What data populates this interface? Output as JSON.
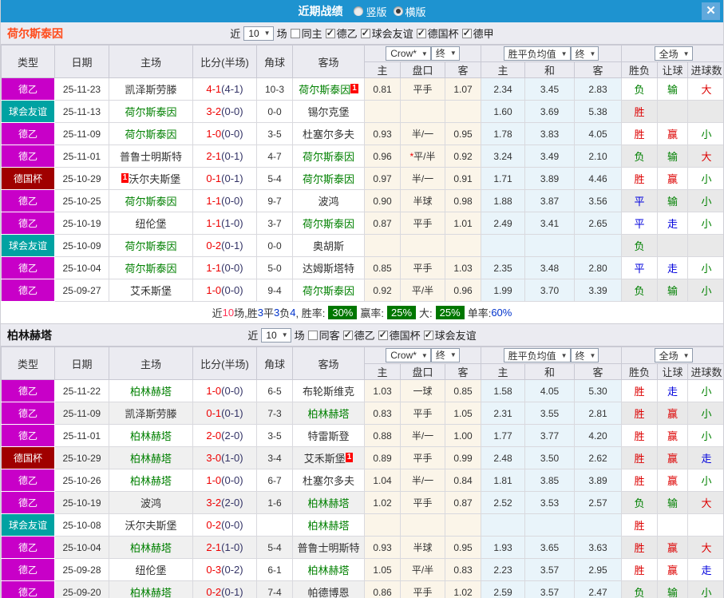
{
  "titlebar": {
    "title": "近期战绩",
    "radios": [
      {
        "label": "竖版",
        "checked": false
      },
      {
        "label": "横版",
        "checked": true
      }
    ],
    "close_icon": "✕"
  },
  "league_colors": {
    "德乙": "#c800c8",
    "球会友谊": "#00a2a2",
    "德国杯": "#a00000"
  },
  "result_colors": {
    "胜": "#dd0000",
    "平": "#0000dd",
    "负": "#008000",
    "赢": "#dd0000",
    "走": "#0000dd",
    "输": "#008000",
    "大": "#dd0000",
    "小": "#008000"
  },
  "summary_text_colors": {
    "k": "#333333",
    "r": "#ff3355",
    "b": "#0033cc"
  },
  "sections": [
    {
      "team": "荷尔斯泰因",
      "team_color": "#ff4a1a",
      "alt_main_shading": false,
      "controls": {
        "near_label": "近",
        "count_value": "10",
        "matches_label": "场",
        "same_checkbox": {
          "label": "同主",
          "checked": false
        },
        "league_checkboxes": [
          {
            "label": "德乙",
            "checked": true
          },
          {
            "label": "球会友谊",
            "checked": true
          },
          {
            "label": "德国杯",
            "checked": true
          },
          {
            "label": "德甲",
            "checked": true
          }
        ]
      },
      "dropdowns": {
        "company": "Crow*",
        "company_state": "终",
        "europe": "胜平负均值",
        "europe_state": "终",
        "scope": "全场"
      },
      "columns": [
        "类型",
        "日期",
        "主场",
        "比分(半场)",
        "角球",
        "客场"
      ],
      "odds_columns": [
        "主",
        "盘口",
        "客",
        "主",
        "和",
        "客",
        "胜负",
        "让球",
        "进球数"
      ],
      "rows": [
        {
          "lg": "德乙",
          "date": "25-11-23",
          "home": {
            "n": "凯泽斯劳滕"
          },
          "score": "4-1",
          "half": "(4-1)",
          "corner": "10-3",
          "away": {
            "n": "荷尔斯泰因",
            "self": true,
            "card": "1",
            "cardpos": "after"
          },
          "ah": [
            "0.81",
            "平手",
            "1.07"
          ],
          "eu": [
            "2.34",
            "3.45",
            "2.83"
          ],
          "res": [
            "负",
            "输",
            "大"
          ]
        },
        {
          "lg": "球会友谊",
          "date": "25-11-13",
          "home": {
            "n": "荷尔斯泰因",
            "self": true
          },
          "score": "3-2",
          "half": "(0-0)",
          "corner": "0-0",
          "away": {
            "n": "锡尔克堡"
          },
          "ah": [
            "",
            "",
            ""
          ],
          "eu": [
            "1.60",
            "3.69",
            "5.38"
          ],
          "res": [
            "胜",
            "",
            ""
          ]
        },
        {
          "lg": "德乙",
          "date": "25-11-09",
          "home": {
            "n": "荷尔斯泰因",
            "self": true
          },
          "score": "1-0",
          "half": "(0-0)",
          "corner": "3-5",
          "away": {
            "n": "杜塞尔多夫"
          },
          "ah": [
            "0.93",
            "半/一",
            "0.95"
          ],
          "eu": [
            "1.78",
            "3.83",
            "4.05"
          ],
          "res": [
            "胜",
            "赢",
            "小"
          ]
        },
        {
          "lg": "德乙",
          "date": "25-11-01",
          "home": {
            "n": "普鲁士明斯特"
          },
          "score": "2-1",
          "half": "(0-1)",
          "corner": "4-7",
          "away": {
            "n": "荷尔斯泰因",
            "self": true
          },
          "ah": [
            "0.96",
            "平/半",
            "0.92"
          ],
          "ah_star": true,
          "eu": [
            "3.24",
            "3.49",
            "2.10"
          ],
          "res": [
            "负",
            "输",
            "大"
          ]
        },
        {
          "lg": "德国杯",
          "date": "25-10-29",
          "home": {
            "n": "沃尔夫斯堡",
            "card": "1",
            "cardpos": "before"
          },
          "score": "0-1",
          "half": "(0-1)",
          "corner": "5-4",
          "away": {
            "n": "荷尔斯泰因",
            "self": true
          },
          "ah": [
            "0.97",
            "半/一",
            "0.91"
          ],
          "eu": [
            "1.71",
            "3.89",
            "4.46"
          ],
          "res": [
            "胜",
            "赢",
            "小"
          ]
        },
        {
          "lg": "德乙",
          "date": "25-10-25",
          "home": {
            "n": "荷尔斯泰因",
            "self": true
          },
          "score": "1-1",
          "half": "(0-0)",
          "corner": "9-7",
          "away": {
            "n": "波鸿"
          },
          "ah": [
            "0.90",
            "半球",
            "0.98"
          ],
          "eu": [
            "1.88",
            "3.87",
            "3.56"
          ],
          "res": [
            "平",
            "输",
            "小"
          ]
        },
        {
          "lg": "德乙",
          "date": "25-10-19",
          "home": {
            "n": "纽伦堡"
          },
          "score": "1-1",
          "half": "(1-0)",
          "corner": "3-7",
          "away": {
            "n": "荷尔斯泰因",
            "self": true
          },
          "ah": [
            "0.87",
            "平手",
            "1.01"
          ],
          "eu": [
            "2.49",
            "3.41",
            "2.65"
          ],
          "res": [
            "平",
            "走",
            "小"
          ]
        },
        {
          "lg": "球会友谊",
          "date": "25-10-09",
          "home": {
            "n": "荷尔斯泰因",
            "self": true
          },
          "score": "0-2",
          "half": "(0-1)",
          "corner": "0-0",
          "away": {
            "n": "奥胡斯"
          },
          "ah": [
            "",
            "",
            ""
          ],
          "eu": [
            "",
            "",
            ""
          ],
          "res": [
            "负",
            "",
            ""
          ]
        },
        {
          "lg": "德乙",
          "date": "25-10-04",
          "home": {
            "n": "荷尔斯泰因",
            "self": true
          },
          "score": "1-1",
          "half": "(0-0)",
          "corner": "5-0",
          "away": {
            "n": "达姆斯塔特"
          },
          "ah": [
            "0.85",
            "平手",
            "1.03"
          ],
          "eu": [
            "2.35",
            "3.48",
            "2.80"
          ],
          "res": [
            "平",
            "走",
            "小"
          ]
        },
        {
          "lg": "德乙",
          "date": "25-09-27",
          "home": {
            "n": "艾禾斯堡"
          },
          "score": "1-0",
          "half": "(0-0)",
          "corner": "9-4",
          "away": {
            "n": "荷尔斯泰因",
            "self": true
          },
          "ah": [
            "0.92",
            "平/半",
            "0.96"
          ],
          "eu": [
            "1.99",
            "3.70",
            "3.39"
          ],
          "res": [
            "负",
            "输",
            "小"
          ]
        }
      ],
      "summary": [
        {
          "t": "近",
          "c": "k"
        },
        {
          "t": "10",
          "c": "r"
        },
        {
          "t": "场,胜",
          "c": "k"
        },
        {
          "t": "3",
          "c": "b"
        },
        {
          "t": "平",
          "c": "k"
        },
        {
          "t": "3",
          "c": "b"
        },
        {
          "t": "负",
          "c": "k"
        },
        {
          "t": "4",
          "c": "b"
        },
        {
          "t": ", 胜率:",
          "c": "k"
        },
        {
          "t": "30%",
          "badge": true
        },
        {
          "t": "赢率:",
          "c": "k"
        },
        {
          "t": "25%",
          "badge": true
        },
        {
          "t": "大:",
          "c": "k"
        },
        {
          "t": "25%",
          "badge": true
        },
        {
          "t": "单率:",
          "c": "k"
        },
        {
          "t": "60%",
          "c": "b"
        }
      ]
    },
    {
      "team": "柏林赫塔",
      "team_color": "#111111",
      "alt_main_shading": true,
      "controls": {
        "near_label": "近",
        "count_value": "10",
        "matches_label": "场",
        "same_checkbox": {
          "label": "同客",
          "checked": false
        },
        "league_checkboxes": [
          {
            "label": "德乙",
            "checked": true
          },
          {
            "label": "德国杯",
            "checked": true
          },
          {
            "label": "球会友谊",
            "checked": true
          }
        ]
      },
      "dropdowns": {
        "company": "Crow*",
        "company_state": "终",
        "europe": "胜平负均值",
        "europe_state": "终",
        "scope": "全场"
      },
      "columns": [
        "类型",
        "日期",
        "主场",
        "比分(半场)",
        "角球",
        "客场"
      ],
      "odds_columns": [
        "主",
        "盘口",
        "客",
        "主",
        "和",
        "客",
        "胜负",
        "让球",
        "进球数"
      ],
      "rows": [
        {
          "lg": "德乙",
          "date": "25-11-22",
          "home": {
            "n": "柏林赫塔",
            "self": true
          },
          "score": "1-0",
          "half": "(0-0)",
          "corner": "6-5",
          "away": {
            "n": "布轮斯维克"
          },
          "ah": [
            "1.03",
            "一球",
            "0.85"
          ],
          "eu": [
            "1.58",
            "4.05",
            "5.30"
          ],
          "res": [
            "胜",
            "走",
            "小"
          ]
        },
        {
          "lg": "德乙",
          "date": "25-11-09",
          "home": {
            "n": "凯泽斯劳滕"
          },
          "score": "0-1",
          "half": "(0-1)",
          "corner": "7-3",
          "away": {
            "n": "柏林赫塔",
            "self": true
          },
          "ah": [
            "0.83",
            "平手",
            "1.05"
          ],
          "eu": [
            "2.31",
            "3.55",
            "2.81"
          ],
          "res": [
            "胜",
            "赢",
            "小"
          ]
        },
        {
          "lg": "德乙",
          "date": "25-11-01",
          "home": {
            "n": "柏林赫塔",
            "self": true
          },
          "score": "2-0",
          "half": "(2-0)",
          "corner": "3-5",
          "away": {
            "n": "特雷斯登"
          },
          "ah": [
            "0.88",
            "半/一",
            "1.00"
          ],
          "eu": [
            "1.77",
            "3.77",
            "4.20"
          ],
          "res": [
            "胜",
            "赢",
            "小"
          ]
        },
        {
          "lg": "德国杯",
          "date": "25-10-29",
          "home": {
            "n": "柏林赫塔",
            "self": true
          },
          "score": "3-0",
          "half": "(1-0)",
          "corner": "3-4",
          "away": {
            "n": "艾禾斯堡",
            "card": "1",
            "cardpos": "after"
          },
          "ah": [
            "0.89",
            "平手",
            "0.99"
          ],
          "eu": [
            "2.48",
            "3.50",
            "2.62"
          ],
          "res": [
            "胜",
            "赢",
            "走"
          ]
        },
        {
          "lg": "德乙",
          "date": "25-10-26",
          "home": {
            "n": "柏林赫塔",
            "self": true
          },
          "score": "1-0",
          "half": "(0-0)",
          "corner": "6-7",
          "away": {
            "n": "杜塞尔多夫"
          },
          "ah": [
            "1.04",
            "半/一",
            "0.84"
          ],
          "eu": [
            "1.81",
            "3.85",
            "3.89"
          ],
          "res": [
            "胜",
            "赢",
            "小"
          ]
        },
        {
          "lg": "德乙",
          "date": "25-10-19",
          "home": {
            "n": "波鸿"
          },
          "score": "3-2",
          "half": "(2-0)",
          "corner": "1-6",
          "away": {
            "n": "柏林赫塔",
            "self": true
          },
          "ah": [
            "1.02",
            "平手",
            "0.87"
          ],
          "eu": [
            "2.52",
            "3.53",
            "2.57"
          ],
          "res": [
            "负",
            "输",
            "大"
          ]
        },
        {
          "lg": "球会友谊",
          "date": "25-10-08",
          "home": {
            "n": "沃尔夫斯堡"
          },
          "score": "0-2",
          "half": "(0-0)",
          "corner": "",
          "away": {
            "n": "柏林赫塔",
            "self": true
          },
          "ah": [
            "",
            "",
            ""
          ],
          "eu": [
            "",
            "",
            ""
          ],
          "res": [
            "胜",
            "",
            ""
          ]
        },
        {
          "lg": "德乙",
          "date": "25-10-04",
          "home": {
            "n": "柏林赫塔",
            "self": true
          },
          "score": "2-1",
          "half": "(1-0)",
          "corner": "5-4",
          "away": {
            "n": "普鲁士明斯特"
          },
          "ah": [
            "0.93",
            "半球",
            "0.95"
          ],
          "eu": [
            "1.93",
            "3.65",
            "3.63"
          ],
          "res": [
            "胜",
            "赢",
            "大"
          ]
        },
        {
          "lg": "德乙",
          "date": "25-09-28",
          "home": {
            "n": "纽伦堡"
          },
          "score": "0-3",
          "half": "(0-2)",
          "corner": "6-1",
          "away": {
            "n": "柏林赫塔",
            "self": true
          },
          "ah": [
            "1.05",
            "平/半",
            "0.83"
          ],
          "eu": [
            "2.23",
            "3.57",
            "2.95"
          ],
          "res": [
            "胜",
            "赢",
            "走"
          ]
        },
        {
          "lg": "德乙",
          "date": "25-09-20",
          "home": {
            "n": "柏林赫塔",
            "self": true
          },
          "score": "0-2",
          "half": "(0-1)",
          "corner": "7-4",
          "away": {
            "n": "帕德博恩"
          },
          "ah": [
            "0.86",
            "平手",
            "1.02"
          ],
          "eu": [
            "2.59",
            "3.57",
            "2.47"
          ],
          "res": [
            "负",
            "输",
            "小"
          ]
        }
      ]
    }
  ]
}
